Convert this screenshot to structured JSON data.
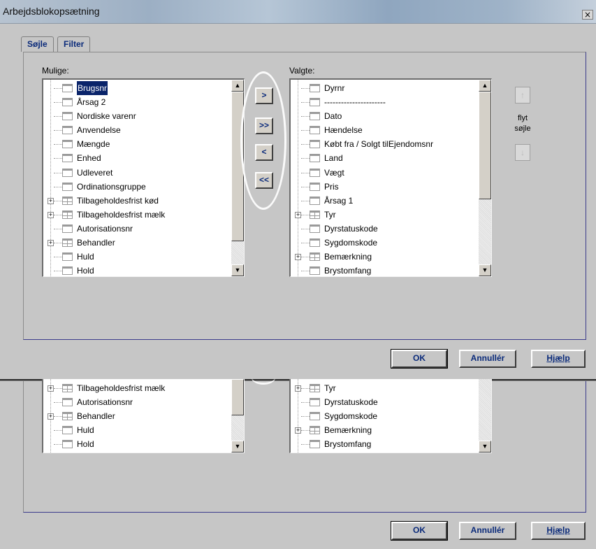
{
  "window": {
    "title": "Arbejdsblokopsætning",
    "close_label": "×"
  },
  "tabs": [
    {
      "label": "Søjle"
    },
    {
      "label": "Filter"
    }
  ],
  "available": {
    "label": "Mulige:",
    "items": [
      {
        "label": "Brugsnr",
        "expandable": false,
        "selected": true
      },
      {
        "label": "Årsag 2",
        "expandable": false
      },
      {
        "label": "Nordiske varenr",
        "expandable": false
      },
      {
        "label": "Anvendelse",
        "expandable": false
      },
      {
        "label": "Mængde",
        "expandable": false
      },
      {
        "label": "Enhed",
        "expandable": false
      },
      {
        "label": "Udleveret",
        "expandable": false
      },
      {
        "label": "Ordinationsgruppe",
        "expandable": false
      },
      {
        "label": "Tilbageholdesfrist kød",
        "expandable": true
      },
      {
        "label": "Tilbageholdesfrist mælk",
        "expandable": true
      },
      {
        "label": "Autorisationsnr",
        "expandable": false
      },
      {
        "label": "Behandler",
        "expandable": true
      },
      {
        "label": "Huld",
        "expandable": false
      },
      {
        "label": "Hold",
        "expandable": false
      }
    ]
  },
  "selected": {
    "label": "Valgte:",
    "items": [
      {
        "label": "Dyrnr",
        "icon": "key-icon"
      },
      {
        "label": "----------------------",
        "icon": "lock-icon"
      },
      {
        "label": "Dato"
      },
      {
        "label": "Hændelse"
      },
      {
        "label": "Købt fra / Solgt tilEjendomsnr"
      },
      {
        "label": "Land"
      },
      {
        "label": "Vægt"
      },
      {
        "label": "Pris"
      },
      {
        "label": "Årsag 1"
      },
      {
        "label": "Tyr",
        "expandable": true
      },
      {
        "label": "Dyrstatuskode"
      },
      {
        "label": "Sygdomskode"
      },
      {
        "label": "Bemærkning",
        "expandable": true
      },
      {
        "label": "Brystomfang"
      }
    ]
  },
  "transfer_buttons": {
    "add": ">",
    "add_all": ">>",
    "remove": "<",
    "remove_all": "<<"
  },
  "move": {
    "up": "↑",
    "down": "↓",
    "label_line1": "flyt",
    "label_line2": "søjle"
  },
  "footer": {
    "ok": "OK",
    "cancel": "Annullér",
    "help": "Hjælp"
  },
  "ghost": {
    "available_items": [
      {
        "label": "Tilbageholdesfrist mælk",
        "expandable": true
      },
      {
        "label": "Autorisationsnr",
        "expandable": false
      },
      {
        "label": "Behandler",
        "expandable": true
      },
      {
        "label": "Huld",
        "expandable": false
      },
      {
        "label": "Hold",
        "expandable": false
      }
    ],
    "selected_items": [
      {
        "label": "Tyr",
        "expandable": true
      },
      {
        "label": "Dyrstatuskode",
        "expandable": false
      },
      {
        "label": "Sygdomskode",
        "expandable": false
      },
      {
        "label": "Bemærkning",
        "expandable": true
      },
      {
        "label": "Brystomfang",
        "expandable": false
      }
    ],
    "footer": {
      "ok": "OK",
      "cancel": "Annullér",
      "help": "Hjælp"
    }
  }
}
